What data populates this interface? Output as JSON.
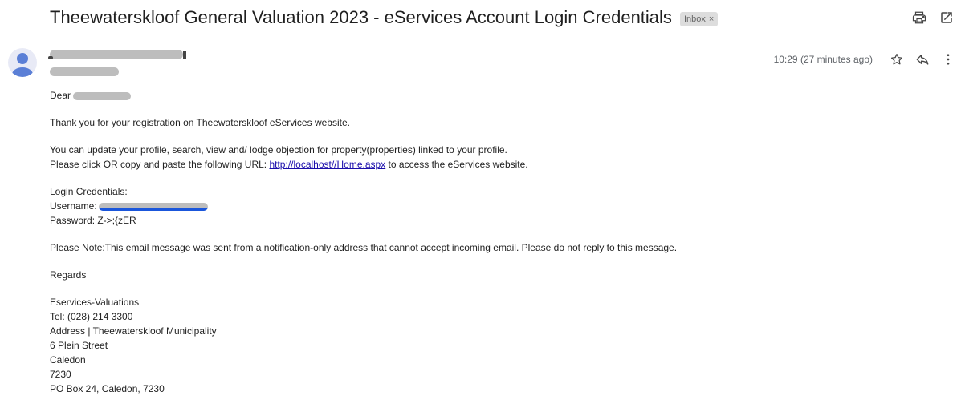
{
  "email": {
    "subject": "Theewaterskloof General Valuation 2023 - eServices Account Login Credentials",
    "label_chip": "Inbox",
    "label_chip_close": "×",
    "timestamp": "10:29 (27 minutes ago)"
  },
  "icons": {
    "print": "print-icon",
    "open_new_window": "open-in-new-window-icon",
    "star": "star-icon",
    "reply": "reply-icon",
    "more": "more-vert-icon",
    "avatar": "account-avatar-icon"
  },
  "body": {
    "greeting": "Dear ",
    "line_thanks": "Thank you for your registration on Theewaterskloof eServices website.",
    "line_update": "You can update your profile, search, view and/ lodge objection for property(properties) linked to your profile.",
    "line_click_prefix": "Please click OR copy and paste the following URL: ",
    "url": "http://localhost//Home.aspx",
    "line_click_suffix": " to access the eServices website.",
    "login_heading": "Login Credentials:",
    "username_label": "Username:",
    "password_line": "Password: Z->;{zER",
    "note": "Please Note:This email message was sent from a notification-only address that cannot accept incoming email. Please do not reply to this message.",
    "regards": "Regards",
    "signature": [
      "Eservices-Valuations",
      "Tel: (028) 214 3300",
      "Address | Theewaterskloof Municipality",
      "6 Plein Street",
      "Caledon",
      "7230",
      "PO Box 24, Caledon, 7230"
    ]
  },
  "colors": {
    "link": "#1a0dab",
    "redaction": "#bdbdbd",
    "avatar_fg": "#5b7fd6"
  }
}
